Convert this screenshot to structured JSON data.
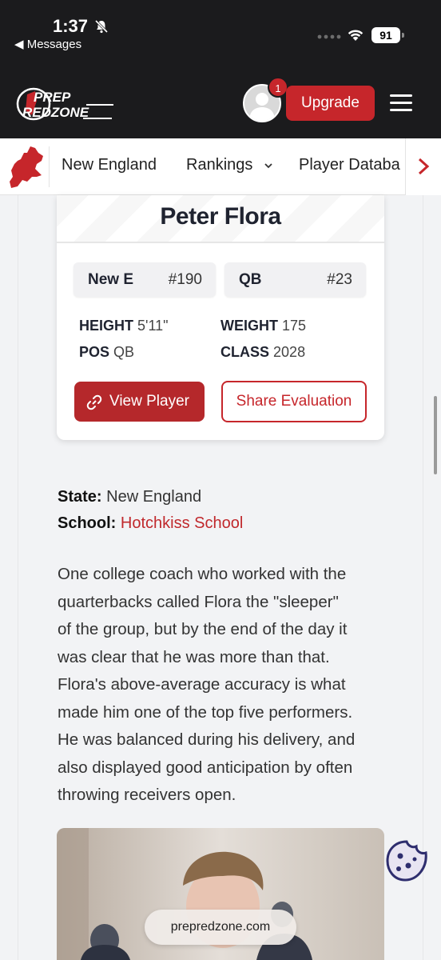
{
  "status": {
    "time": "1:37",
    "back_label": "◀ Messages",
    "battery": "91"
  },
  "header": {
    "logo_line1": "PREP",
    "logo_line2": "REDZONE",
    "notification_count": "1",
    "upgrade_label": "Upgrade"
  },
  "nav": {
    "items": [
      "New England",
      "Rankings",
      "Player Databa"
    ]
  },
  "player": {
    "name": "Peter Flora",
    "state_rank_label": "New E",
    "state_rank": "#190",
    "pos_rank_label": "QB",
    "pos_rank": "#23",
    "height_label": "HEIGHT",
    "height": "5'11\"",
    "weight_label": "WEIGHT",
    "weight": "175",
    "pos_label": "POS",
    "pos": "QB",
    "class_label": "CLASS",
    "class_year": "2028",
    "view_label": "View Player",
    "share_label": "Share Evaluation"
  },
  "meta": {
    "state_label": "State:",
    "state": "New England",
    "school_label": "School:",
    "school": "Hotchkiss School"
  },
  "article": {
    "lines": [
      "One college coach who worked with the",
      "quarterbacks called Flora the \"sleeper\"",
      "of the group, but by the end of the day it",
      "was clear that he was more than that.",
      "Flora's above-average accuracy is what",
      "made him one of the top five performers.",
      "He was balanced during his delivery, and",
      "also displayed good anticipation by often",
      "throwing receivers open."
    ]
  },
  "browser": {
    "url": "prepredzone.com"
  },
  "colors": {
    "brand_red": "#c6262b",
    "header_bg": "#1b1b1d"
  }
}
